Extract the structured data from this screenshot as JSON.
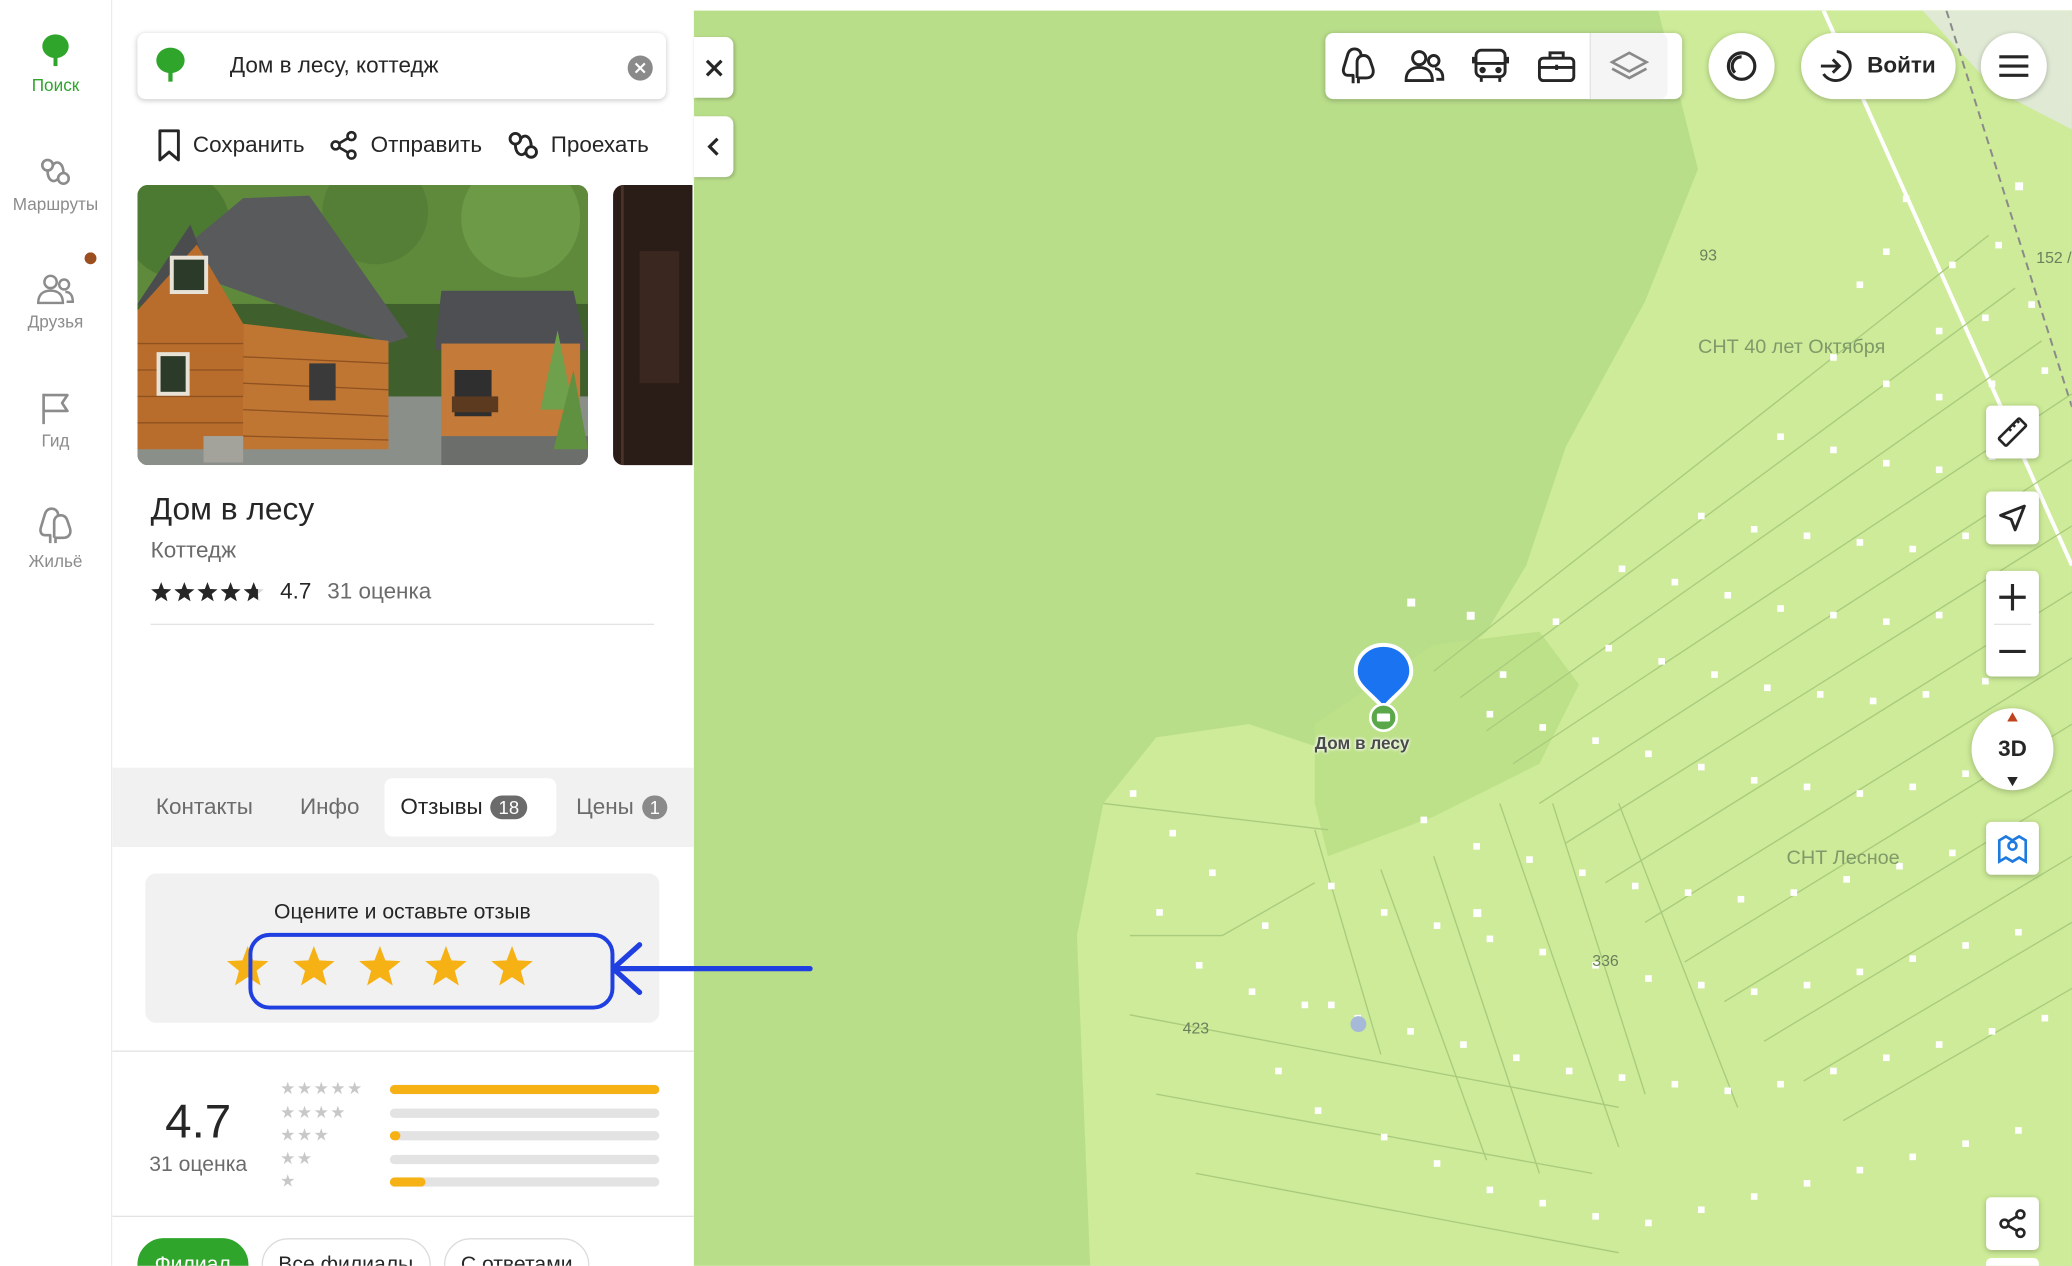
{
  "rail": {
    "items": [
      {
        "label": "Поиск",
        "icon": "tree-logo-icon",
        "active": true
      },
      {
        "label": "Маршруты",
        "icon": "routes-icon"
      },
      {
        "label": "Друзья",
        "icon": "friends-icon"
      },
      {
        "label": "Гид",
        "icon": "flag-icon"
      },
      {
        "label": "Жильё",
        "icon": "housing-icon"
      }
    ]
  },
  "search": {
    "value": "Дом в лесу, коттедж"
  },
  "actions": {
    "save": "Сохранить",
    "share": "Отправить",
    "route": "Проехать"
  },
  "place": {
    "title": "Дом в лесу",
    "category": "Коттедж",
    "rating": "4.7",
    "rating_count": "31 оценка",
    "stars": 4.7
  },
  "tabs": [
    {
      "label": "Контакты"
    },
    {
      "label": "Инфо"
    },
    {
      "label": "Отзывы",
      "badge": "18",
      "active": true
    },
    {
      "label": "Цены",
      "badge": "1"
    }
  ],
  "rate_prompt": "Оцените и оставьте отзыв",
  "summary": {
    "rating": "4.7",
    "count": "31 оценка",
    "distribution": [
      {
        "stars": 5,
        "fraction": 1.0
      },
      {
        "stars": 4,
        "fraction": 0.0
      },
      {
        "stars": 3,
        "fraction": 0.04
      },
      {
        "stars": 2,
        "fraction": 0.0
      },
      {
        "stars": 1,
        "fraction": 0.13
      }
    ]
  },
  "chips": [
    "Филиал",
    "Все филиалы",
    "С ответами"
  ],
  "map": {
    "login": "Войти",
    "btn_3d": "3D",
    "pin_label": "Дом в лесу",
    "labels": {
      "snt1": "СНТ 40 лет Октября",
      "snt2": "СНТ Лесное"
    },
    "numbers": {
      "n93": "93",
      "n152": "152 /",
      "n336": "336",
      "n423": "423"
    }
  },
  "colors": {
    "brand_green": "#2fa52c",
    "pin_blue": "#1a73f0",
    "star_gold": "#f6b115",
    "highlight_blue": "#1f3fe0",
    "map_forest": "#b4dc84",
    "map_open": "#cdeb98"
  }
}
